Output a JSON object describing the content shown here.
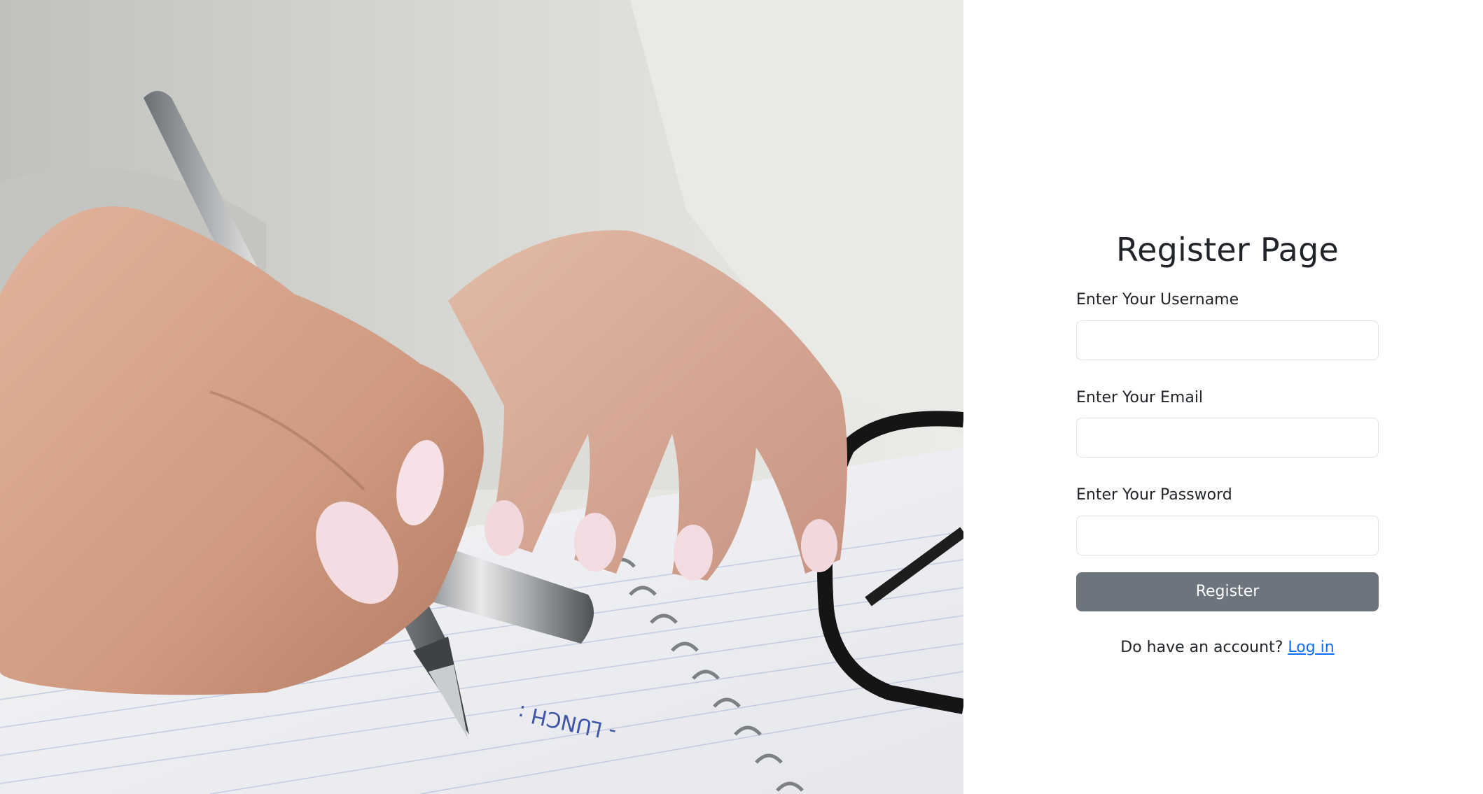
{
  "hero_image": {
    "alt_icon": "hand-writing-photo",
    "notebook_text": "- LUNCH :"
  },
  "form": {
    "title": "Register Page",
    "username": {
      "label": "Enter Your Username",
      "value": "",
      "placeholder": ""
    },
    "email": {
      "label": "Enter Your Email",
      "value": "",
      "placeholder": ""
    },
    "password": {
      "label": "Enter Your Password",
      "value": "",
      "placeholder": ""
    },
    "submit_label": "Register",
    "login_prompt": "Do have an account?",
    "login_link": "Log in"
  },
  "colors": {
    "button_bg": "#6c757d",
    "link": "#0d6efd",
    "text": "#212529",
    "input_border": "#dee2e6"
  }
}
